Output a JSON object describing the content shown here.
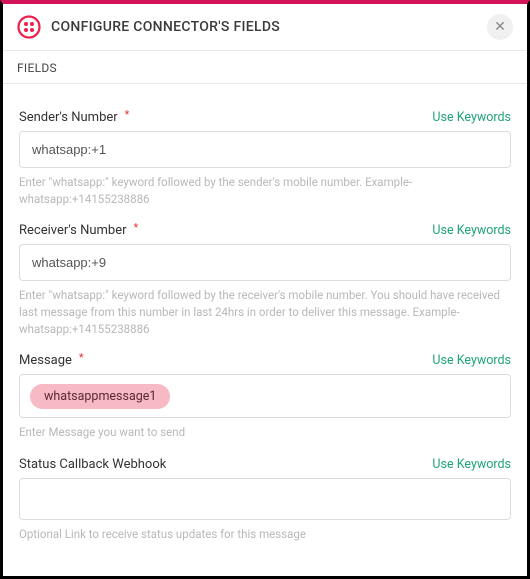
{
  "header": {
    "title": "CONFIGURE CONNECTOR'S FIELDS",
    "close_label": "✕"
  },
  "section_label": "FIELDS",
  "use_keywords_label": "Use Keywords",
  "required_mark": "*",
  "fields": {
    "sender": {
      "label": "Sender's Number",
      "value": "whatsapp:+1",
      "helper": "Enter \"whatsapp:\" keyword followed by the sender's mobile number. Example- whatsapp:+14155238886",
      "required": true
    },
    "receiver": {
      "label": "Receiver's Number",
      "value": "whatsapp:+9",
      "helper": "Enter \"whatsapp:\" keyword followed by the receiver's mobile number. You should have received last message from this number in last 24hrs in order to deliver this message. Example- whatsapp:+14155238886",
      "required": true
    },
    "message": {
      "label": "Message",
      "chip": "whatsappmessage1",
      "helper": "Enter Message you want to send",
      "required": true
    },
    "callback": {
      "label": "Status Callback Webhook",
      "value": "",
      "helper": "Optional Link to receive status updates for this message",
      "required": false
    }
  }
}
